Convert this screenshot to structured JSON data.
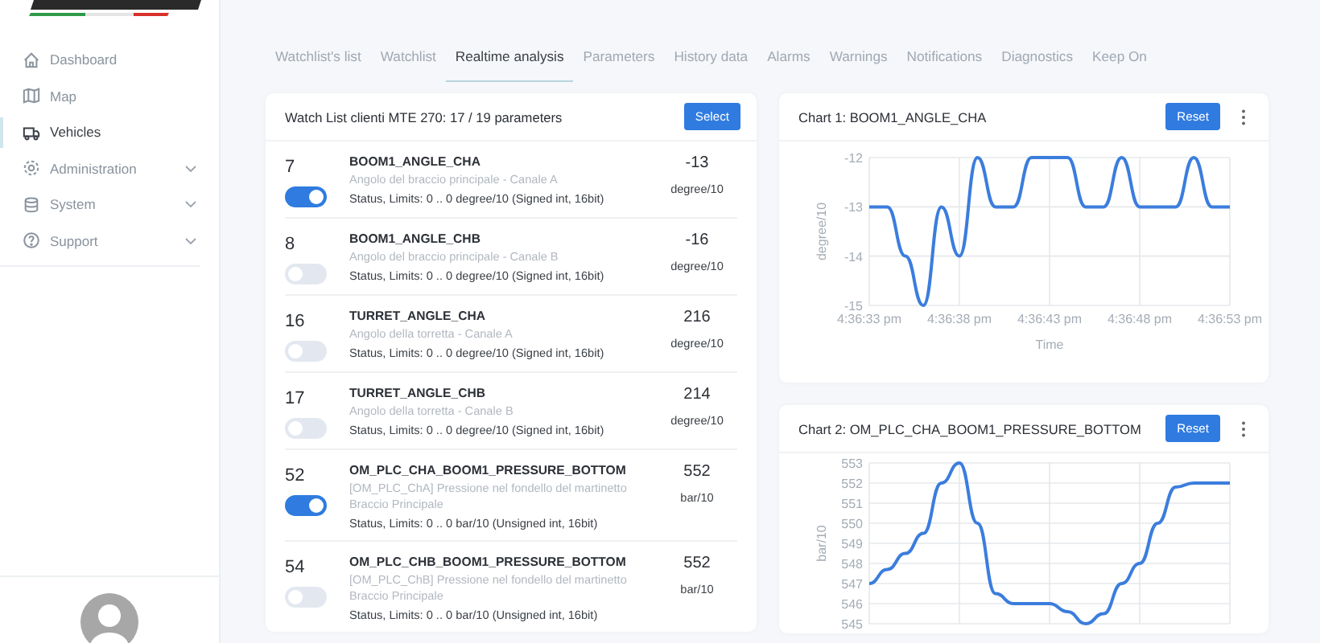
{
  "sidebar": {
    "items": [
      {
        "label": "Dashboard",
        "selected": false,
        "has_submenu": false
      },
      {
        "label": "Map",
        "selected": false,
        "has_submenu": false
      },
      {
        "label": "Vehicles",
        "selected": true,
        "has_submenu": false
      },
      {
        "label": "Administration",
        "selected": false,
        "has_submenu": true
      },
      {
        "label": "System",
        "selected": false,
        "has_submenu": true
      },
      {
        "label": "Support",
        "selected": false,
        "has_submenu": true
      }
    ]
  },
  "tabs": [
    {
      "label": "Watchlist's list",
      "selected": false
    },
    {
      "label": "Watchlist",
      "selected": false
    },
    {
      "label": "Realtime analysis",
      "selected": true
    },
    {
      "label": "Parameters",
      "selected": false
    },
    {
      "label": "History data",
      "selected": false
    },
    {
      "label": "Alarms",
      "selected": false
    },
    {
      "label": "Warnings",
      "selected": false
    },
    {
      "label": "Notifications",
      "selected": false
    },
    {
      "label": "Diagnostics",
      "selected": false
    },
    {
      "label": "Keep On",
      "selected": false
    }
  ],
  "watchlist": {
    "title": "Watch List clienti MTE 270: 17 / 19 parameters",
    "select_button": "Select",
    "rows": [
      {
        "id": "7",
        "name": "BOOM1_ANGLE_CHA",
        "description": "Angolo del braccio principale - Canale A",
        "status": "Status, Limits: 0 .. 0 degree/10 (Signed int, 16bit)",
        "value": "-13",
        "unit": "degree/10",
        "enabled": true
      },
      {
        "id": "8",
        "name": "BOOM1_ANGLE_CHB",
        "description": "Angolo del braccio principale - Canale B",
        "status": "Status, Limits: 0 .. 0 degree/10 (Signed int, 16bit)",
        "value": "-16",
        "unit": "degree/10",
        "enabled": false
      },
      {
        "id": "16",
        "name": "TURRET_ANGLE_CHA",
        "description": "Angolo della torretta - Canale A",
        "status": "Status, Limits: 0 .. 0 degree/10 (Signed int, 16bit)",
        "value": "216",
        "unit": "degree/10",
        "enabled": false
      },
      {
        "id": "17",
        "name": "TURRET_ANGLE_CHB",
        "description": "Angolo della torretta - Canale B",
        "status": "Status, Limits: 0 .. 0 degree/10 (Signed int, 16bit)",
        "value": "214",
        "unit": "degree/10",
        "enabled": false
      },
      {
        "id": "52",
        "name": "OM_PLC_CHA_BOOM1_PRESSURE_BOTTOM",
        "description": "[OM_PLC_ChA] Pressione nel fondello del martinetto Braccio Principale",
        "status": "Status, Limits: 0 .. 0 bar/10 (Unsigned int, 16bit)",
        "value": "552",
        "unit": "bar/10",
        "enabled": true
      },
      {
        "id": "54",
        "name": "OM_PLC_CHB_BOOM1_PRESSURE_BOTTOM",
        "description": "[OM_PLC_ChB] Pressione nel fondello del martinetto Braccio Principale",
        "status": "Status, Limits: 0 .. 0 bar/10 (Unsigned int, 16bit)",
        "value": "552",
        "unit": "bar/10",
        "enabled": false
      }
    ]
  },
  "charts": [
    {
      "title": "Chart 1: BOOM1_ANGLE_CHA",
      "reset_button": "Reset",
      "chart_data": {
        "type": "line",
        "xlabel": "Time",
        "ylabel": "degree/10",
        "color": "#3b7ddd",
        "categories": [
          "4:36:33 pm",
          null,
          null,
          null,
          null,
          "4:36:38 pm",
          null,
          null,
          null,
          null,
          "4:36:43 pm",
          null,
          null,
          null,
          null,
          "4:36:48 pm",
          null,
          null,
          null,
          null,
          "4:36:53 pm"
        ],
        "values": [
          -13,
          -13,
          -14,
          -15,
          -13,
          -14,
          -12,
          -13,
          -13,
          -12,
          -12,
          -12,
          -13,
          -13,
          -12,
          -13,
          -13,
          -13,
          -12,
          -13,
          -13
        ],
        "grid": true,
        "ylim": [
          -15,
          -12
        ],
        "yticks": [
          -12,
          -13,
          -14,
          -15
        ]
      }
    },
    {
      "title": "Chart 2: OM_PLC_CHA_BOOM1_PRESSURE_BOTTOM",
      "reset_button": "Reset",
      "chart_data": {
        "type": "line",
        "ylabel": "bar/10",
        "color": "#3b7ddd",
        "categories": [
          null,
          null,
          null,
          null,
          null,
          null,
          null,
          null,
          null,
          null,
          null,
          null,
          null,
          null,
          null,
          null,
          null,
          null,
          null,
          null,
          null
        ],
        "values": [
          547,
          547.7,
          548.5,
          549.5,
          552,
          553,
          550,
          546.5,
          546,
          546,
          546,
          545.6,
          545,
          545.5,
          547,
          548,
          550,
          551.8,
          552,
          552,
          552
        ],
        "grid": true,
        "ylim": [
          545,
          553
        ],
        "yticks": [
          553,
          552,
          551,
          550,
          549,
          548,
          547,
          546,
          545
        ]
      }
    }
  ]
}
